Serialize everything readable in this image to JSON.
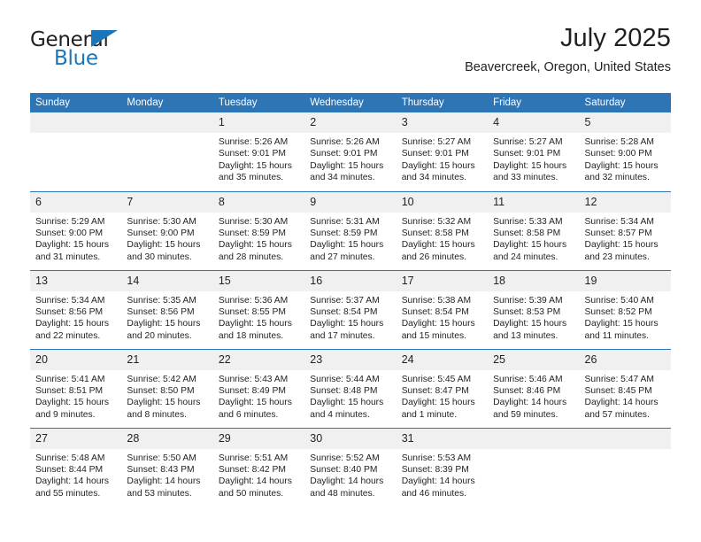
{
  "logo": {
    "word_one": "General",
    "word_two": "Blue",
    "triangle_icon": "triangle-icon",
    "accent_color": "#1b75bb"
  },
  "header": {
    "title": "July 2025",
    "location": "Beavercreek, Oregon, United States",
    "header_bg_color": "#2e75b6",
    "daynum_bg_color": "#f0f0f0"
  },
  "weekday_headers": [
    "Sunday",
    "Monday",
    "Tuesday",
    "Wednesday",
    "Thursday",
    "Friday",
    "Saturday"
  ],
  "labels": {
    "sunrise": "Sunrise:",
    "sunset": "Sunset:",
    "daylight": "Daylight:"
  },
  "weeks": [
    [
      {
        "day": "",
        "empty": true
      },
      {
        "day": "",
        "empty": true
      },
      {
        "day": "1",
        "sunrise": "Sunrise: 5:26 AM",
        "sunset": "Sunset: 9:01 PM",
        "daylight": "Daylight: 15 hours and 35 minutes."
      },
      {
        "day": "2",
        "sunrise": "Sunrise: 5:26 AM",
        "sunset": "Sunset: 9:01 PM",
        "daylight": "Daylight: 15 hours and 34 minutes."
      },
      {
        "day": "3",
        "sunrise": "Sunrise: 5:27 AM",
        "sunset": "Sunset: 9:01 PM",
        "daylight": "Daylight: 15 hours and 34 minutes."
      },
      {
        "day": "4",
        "sunrise": "Sunrise: 5:27 AM",
        "sunset": "Sunset: 9:01 PM",
        "daylight": "Daylight: 15 hours and 33 minutes."
      },
      {
        "day": "5",
        "sunrise": "Sunrise: 5:28 AM",
        "sunset": "Sunset: 9:00 PM",
        "daylight": "Daylight: 15 hours and 32 minutes."
      }
    ],
    [
      {
        "day": "6",
        "sunrise": "Sunrise: 5:29 AM",
        "sunset": "Sunset: 9:00 PM",
        "daylight": "Daylight: 15 hours and 31 minutes."
      },
      {
        "day": "7",
        "sunrise": "Sunrise: 5:30 AM",
        "sunset": "Sunset: 9:00 PM",
        "daylight": "Daylight: 15 hours and 30 minutes."
      },
      {
        "day": "8",
        "sunrise": "Sunrise: 5:30 AM",
        "sunset": "Sunset: 8:59 PM",
        "daylight": "Daylight: 15 hours and 28 minutes."
      },
      {
        "day": "9",
        "sunrise": "Sunrise: 5:31 AM",
        "sunset": "Sunset: 8:59 PM",
        "daylight": "Daylight: 15 hours and 27 minutes."
      },
      {
        "day": "10",
        "sunrise": "Sunrise: 5:32 AM",
        "sunset": "Sunset: 8:58 PM",
        "daylight": "Daylight: 15 hours and 26 minutes."
      },
      {
        "day": "11",
        "sunrise": "Sunrise: 5:33 AM",
        "sunset": "Sunset: 8:58 PM",
        "daylight": "Daylight: 15 hours and 24 minutes."
      },
      {
        "day": "12",
        "sunrise": "Sunrise: 5:34 AM",
        "sunset": "Sunset: 8:57 PM",
        "daylight": "Daylight: 15 hours and 23 minutes."
      }
    ],
    [
      {
        "day": "13",
        "sunrise": "Sunrise: 5:34 AM",
        "sunset": "Sunset: 8:56 PM",
        "daylight": "Daylight: 15 hours and 22 minutes."
      },
      {
        "day": "14",
        "sunrise": "Sunrise: 5:35 AM",
        "sunset": "Sunset: 8:56 PM",
        "daylight": "Daylight: 15 hours and 20 minutes."
      },
      {
        "day": "15",
        "sunrise": "Sunrise: 5:36 AM",
        "sunset": "Sunset: 8:55 PM",
        "daylight": "Daylight: 15 hours and 18 minutes."
      },
      {
        "day": "16",
        "sunrise": "Sunrise: 5:37 AM",
        "sunset": "Sunset: 8:54 PM",
        "daylight": "Daylight: 15 hours and 17 minutes."
      },
      {
        "day": "17",
        "sunrise": "Sunrise: 5:38 AM",
        "sunset": "Sunset: 8:54 PM",
        "daylight": "Daylight: 15 hours and 15 minutes."
      },
      {
        "day": "18",
        "sunrise": "Sunrise: 5:39 AM",
        "sunset": "Sunset: 8:53 PM",
        "daylight": "Daylight: 15 hours and 13 minutes."
      },
      {
        "day": "19",
        "sunrise": "Sunrise: 5:40 AM",
        "sunset": "Sunset: 8:52 PM",
        "daylight": "Daylight: 15 hours and 11 minutes."
      }
    ],
    [
      {
        "day": "20",
        "sunrise": "Sunrise: 5:41 AM",
        "sunset": "Sunset: 8:51 PM",
        "daylight": "Daylight: 15 hours and 9 minutes."
      },
      {
        "day": "21",
        "sunrise": "Sunrise: 5:42 AM",
        "sunset": "Sunset: 8:50 PM",
        "daylight": "Daylight: 15 hours and 8 minutes."
      },
      {
        "day": "22",
        "sunrise": "Sunrise: 5:43 AM",
        "sunset": "Sunset: 8:49 PM",
        "daylight": "Daylight: 15 hours and 6 minutes."
      },
      {
        "day": "23",
        "sunrise": "Sunrise: 5:44 AM",
        "sunset": "Sunset: 8:48 PM",
        "daylight": "Daylight: 15 hours and 4 minutes."
      },
      {
        "day": "24",
        "sunrise": "Sunrise: 5:45 AM",
        "sunset": "Sunset: 8:47 PM",
        "daylight": "Daylight: 15 hours and 1 minute."
      },
      {
        "day": "25",
        "sunrise": "Sunrise: 5:46 AM",
        "sunset": "Sunset: 8:46 PM",
        "daylight": "Daylight: 14 hours and 59 minutes."
      },
      {
        "day": "26",
        "sunrise": "Sunrise: 5:47 AM",
        "sunset": "Sunset: 8:45 PM",
        "daylight": "Daylight: 14 hours and 57 minutes."
      }
    ],
    [
      {
        "day": "27",
        "sunrise": "Sunrise: 5:48 AM",
        "sunset": "Sunset: 8:44 PM",
        "daylight": "Daylight: 14 hours and 55 minutes."
      },
      {
        "day": "28",
        "sunrise": "Sunrise: 5:50 AM",
        "sunset": "Sunset: 8:43 PM",
        "daylight": "Daylight: 14 hours and 53 minutes."
      },
      {
        "day": "29",
        "sunrise": "Sunrise: 5:51 AM",
        "sunset": "Sunset: 8:42 PM",
        "daylight": "Daylight: 14 hours and 50 minutes."
      },
      {
        "day": "30",
        "sunrise": "Sunrise: 5:52 AM",
        "sunset": "Sunset: 8:40 PM",
        "daylight": "Daylight: 14 hours and 48 minutes."
      },
      {
        "day": "31",
        "sunrise": "Sunrise: 5:53 AM",
        "sunset": "Sunset: 8:39 PM",
        "daylight": "Daylight: 14 hours and 46 minutes."
      },
      {
        "day": "",
        "empty": true
      },
      {
        "day": "",
        "empty": true
      }
    ]
  ]
}
